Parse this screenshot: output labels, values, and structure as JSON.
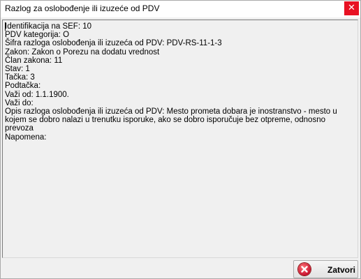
{
  "window": {
    "title": "Razlog za oslobođenje ili izuzeće od PDV",
    "close_glyph": "✕"
  },
  "details": {
    "lines": [
      "Identifikacija na SEF: 10",
      "PDV kategorija: O",
      "Šifra razloga oslobođenja ili izuzeća od PDV: PDV-RS-11-1-3",
      "Zakon: Zakon o Porezu na dodatu vrednost",
      "Član zakona: 11",
      "Stav: 1",
      "Tačka: 3",
      "Podtačka:",
      "Važi od: 1.1.1900.",
      "Važi do:",
      "Opis razloga oslobođenja ili izuzeća od PDV: Mesto prometa dobara je inostranstvo - mesto u kojem se dobro nalazi u trenutku isporuke, ako se dobro isporučuje bez otpreme, odnosno prevoza",
      "Napomena:"
    ]
  },
  "footer": {
    "close_label": "Zatvori",
    "close_icon": "red-x-circle-icon"
  },
  "colors": {
    "close_red": "#e81123",
    "background": "#f0f0f0"
  }
}
